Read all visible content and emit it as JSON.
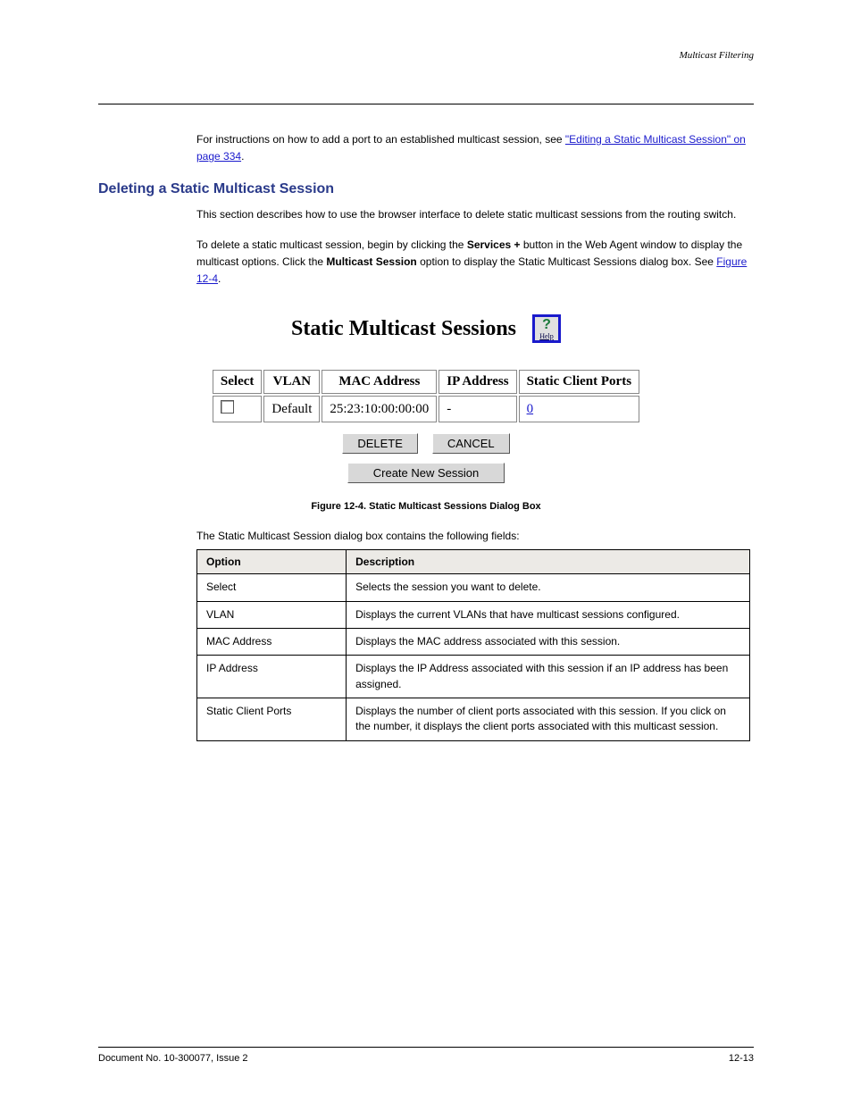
{
  "header": {
    "right": "Multicast Filtering"
  },
  "intro": {
    "p1_prefix": "For instructions on how to add a port to an established multicast session, see ",
    "p1_link": "\"Editing a Static Multicast Session\" on page 334",
    "p1_suffix": "."
  },
  "section": {
    "title": "Deleting a Static Multicast Session",
    "p1": "This section describes how to use the browser interface to delete static multicast sessions from the routing switch.",
    "p2_prefix": "To delete a static multicast session, begin by clicking the ",
    "p2_bold": "Services +",
    "p2_mid": " button in the Web Agent window to display the multicast options. Click the ",
    "p2_bold2": "Multicast Session",
    "p2_end": " option to display the Static Multicast Sessions dialog box. See ",
    "p2_linktext": "Figure 12-4",
    "p2_after": "."
  },
  "screenshot": {
    "title": "Static Multicast Sessions",
    "help_label": "Help",
    "table": {
      "headers": [
        "Select",
        "VLAN",
        "MAC Address",
        "IP Address",
        "Static Client Ports"
      ],
      "row": {
        "vlan": "Default",
        "mac": "25:23:10:00:00:00",
        "ip": "-",
        "ports": "0"
      }
    },
    "buttons": {
      "delete": "DELETE",
      "cancel": "CANCEL",
      "create": "Create New Session"
    }
  },
  "figure_caption": "Figure 12-4.  Static Multicast Sessions Dialog Box",
  "desc_intro": "The Static Multicast Session dialog box contains the following fields:",
  "desc_table": {
    "headers": [
      "Option",
      "Description"
    ],
    "rows": [
      {
        "opt": "Select",
        "desc": "Selects the session you want to delete."
      },
      {
        "opt": "VLAN",
        "desc": "Displays the current VLANs that have multicast sessions configured."
      },
      {
        "opt": "MAC Address",
        "desc": "Displays the MAC address associated with this session."
      },
      {
        "opt": "IP Address",
        "desc": "Displays the IP Address associated with this session if an IP address has been assigned."
      },
      {
        "opt": "Static Client Ports",
        "desc": "Displays the number of client ports associated with this session. If you click on the number, it displays the client ports associated with this multicast session."
      }
    ]
  },
  "footer": {
    "left": "Document No. 10-300077, Issue 2",
    "right": "12-13"
  }
}
